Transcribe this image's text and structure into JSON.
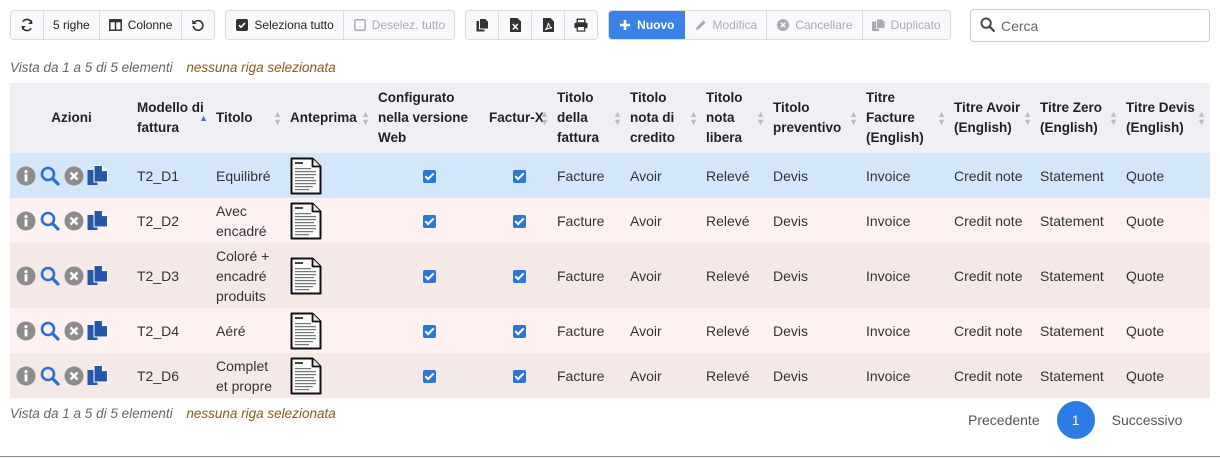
{
  "toolbar": {
    "rows_label": "5 righe",
    "columns_label": "Colonne",
    "select_all_label": "Seleziona tutto",
    "deselect_all_label": "Deselez. tutto",
    "new_label": "Nuovo",
    "edit_label": "Modifica",
    "delete_label": "Cancellare",
    "duplicate_label": "Duplicato"
  },
  "search": {
    "placeholder": "Cerca",
    "value": ""
  },
  "info": {
    "range": "Vista da 1 a 5 di 5 elementi",
    "selection": "nessuna riga selezionata"
  },
  "columns": [
    "Azioni",
    "Modello di fattura",
    "Titolo",
    "Anteprima",
    "Configurato nella versione Web",
    "Factur-X",
    "Titolo della fattura",
    "Titolo nota di credito",
    "Titolo nota libera",
    "Titolo preventivo",
    "Titre Facture (English)",
    "Titre Avoir (English)",
    "Titre Zero (English)",
    "Titre Devis (English)"
  ],
  "rows": [
    {
      "model": "T2_D1",
      "title": "Equilibré",
      "web": true,
      "facturx": true,
      "invoice": "Facture",
      "credit": "Avoir",
      "free": "Relevé",
      "quote": "Devis",
      "en_invoice": "Invoice",
      "en_credit": "Credit note",
      "en_zero": "Statement",
      "en_quote": "Quote"
    },
    {
      "model": "T2_D2",
      "title": "Avec encadré",
      "web": true,
      "facturx": true,
      "invoice": "Facture",
      "credit": "Avoir",
      "free": "Relevé",
      "quote": "Devis",
      "en_invoice": "Invoice",
      "en_credit": "Credit note",
      "en_zero": "Statement",
      "en_quote": "Quote"
    },
    {
      "model": "T2_D3",
      "title": "Coloré + encadré produits",
      "web": true,
      "facturx": true,
      "invoice": "Facture",
      "credit": "Avoir",
      "free": "Relevé",
      "quote": "Devis",
      "en_invoice": "Invoice",
      "en_credit": "Credit note",
      "en_zero": "Statement",
      "en_quote": "Quote"
    },
    {
      "model": "T2_D4",
      "title": "Aéré",
      "web": true,
      "facturx": true,
      "invoice": "Facture",
      "credit": "Avoir",
      "free": "Relevé",
      "quote": "Devis",
      "en_invoice": "Invoice",
      "en_credit": "Credit note",
      "en_zero": "Statement",
      "en_quote": "Quote"
    },
    {
      "model": "T2_D6",
      "title": "Complet et propre",
      "web": true,
      "facturx": true,
      "invoice": "Facture",
      "credit": "Avoir",
      "free": "Relevé",
      "quote": "Devis",
      "en_invoice": "Invoice",
      "en_credit": "Credit note",
      "en_zero": "Statement",
      "en_quote": "Quote"
    }
  ],
  "pagination": {
    "prev_label": "Precedente",
    "current_page": "1",
    "next_label": "Successivo"
  },
  "colors": {
    "accent": "#3b82e6",
    "selected_row": "#d4e6f9",
    "row_a": "#fdf2f1",
    "row_b": "#f5e9e8",
    "selection_text": "#8a5a1b"
  },
  "icons": [
    "refresh-icon",
    "columns-icon",
    "undo-icon",
    "checkbox-checked-icon",
    "checkbox-empty-icon",
    "copy-icon",
    "excel-icon",
    "pdf-icon",
    "print-icon",
    "plus-icon",
    "pencil-icon",
    "delete-circle-icon",
    "duplicate-icon",
    "search-icon",
    "info-icon",
    "magnifier-icon",
    "clone-icon",
    "document-preview-icon"
  ]
}
